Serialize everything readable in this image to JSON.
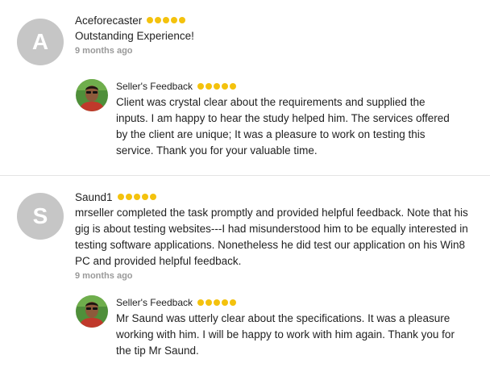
{
  "reviews": [
    {
      "avatar_letter": "A",
      "username": "Aceforecaster",
      "rating": 5,
      "text": "Outstanding Experience!",
      "time": "9 months ago",
      "seller_feedback": {
        "title": "Seller's Feedback",
        "rating": 5,
        "text": "Client was crystal clear about the requirements and supplied the inputs. I am happy to hear the study helped him. The services offered by the client are unique; It was a pleasure to work on testing this service. Thank you for your valuable time."
      }
    },
    {
      "avatar_letter": "S",
      "username": "Saund1",
      "rating": 5,
      "text": "mrseller completed the task promptly and provided helpful feedback. Note that his gig is about testing websites---I had misunderstood him to be equally interested in testing software applications. Nonetheless he did test our application on his Win8 PC and provided helpful feedback.",
      "time": "9 months ago",
      "seller_feedback": {
        "title": "Seller's Feedback",
        "rating": 5,
        "text": "Mr Saund was utterly clear about the specifications. It was a pleasure working with him. I will be happy to work with him again. Thank you for the tip Mr Saund."
      }
    }
  ],
  "colors": {
    "star": "#f4c20d",
    "avatar_bg": "#c6c6c6",
    "time_text": "#9a9a9a",
    "divider": "#e4e4e4"
  }
}
